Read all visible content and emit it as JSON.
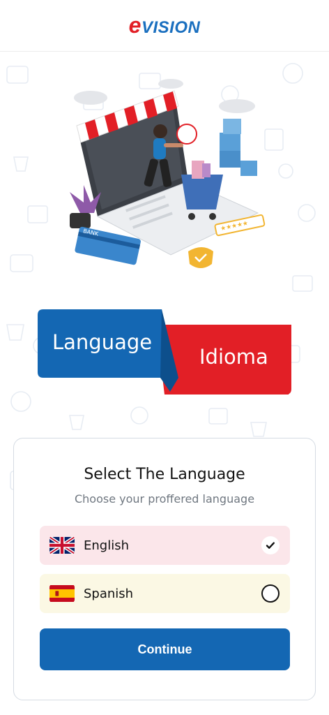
{
  "header": {
    "logo_e": "e",
    "logo_rest": "VISION"
  },
  "banner": {
    "left_text": "Language",
    "right_text": "Idioma"
  },
  "card": {
    "title": "Select The Language",
    "subtitle": "Choose your proffered language",
    "options": [
      {
        "label": "English",
        "selected": true
      },
      {
        "label": "Spanish",
        "selected": false
      }
    ],
    "continue_label": "Continue"
  },
  "hero": {
    "card_label": "BANK"
  },
  "colors": {
    "brand_red": "#e21f26",
    "brand_blue": "#1467b3"
  }
}
